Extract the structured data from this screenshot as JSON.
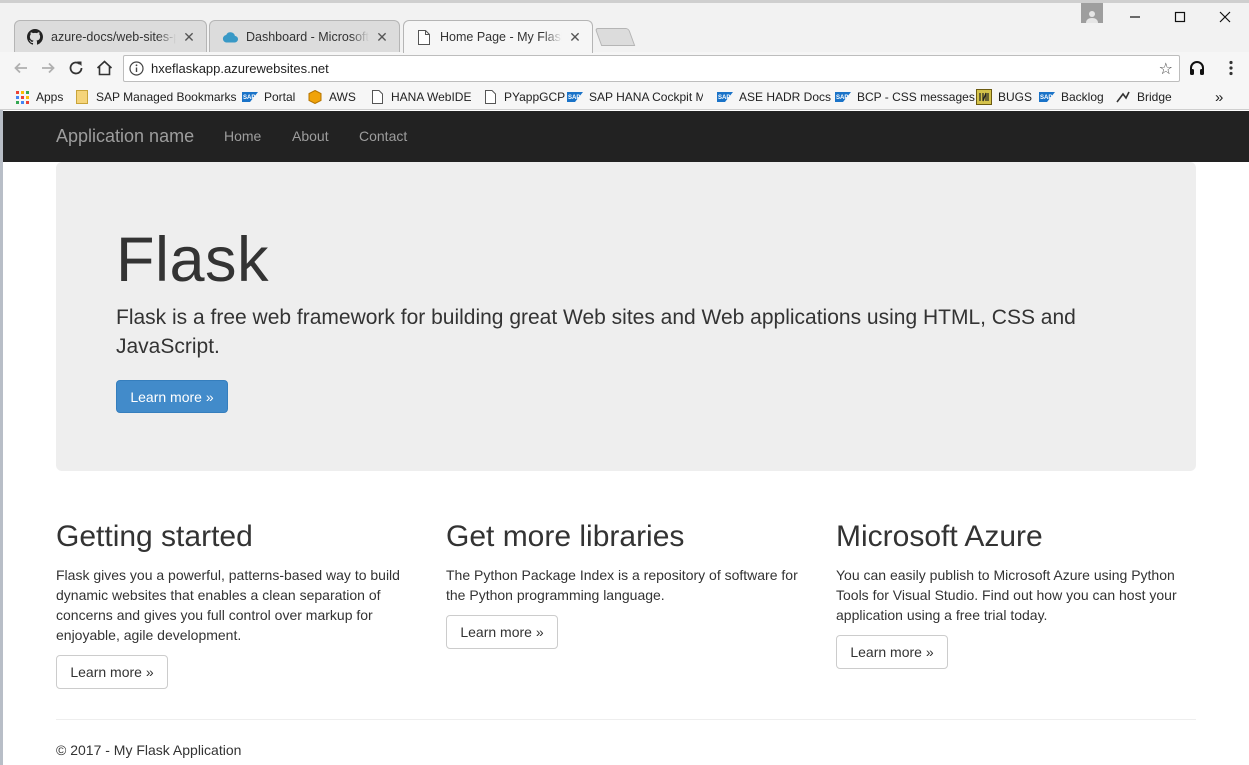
{
  "browser": {
    "tabs": [
      {
        "title": "azure-docs/web-sites-py",
        "icon": "github-icon"
      },
      {
        "title": "Dashboard - Microsoft A",
        "icon": "azure-cloud-icon"
      },
      {
        "title": "Home Page - My Flask Ap",
        "icon": "page-icon",
        "active": true
      }
    ],
    "tab_close": "✕",
    "address": "hxeflaskapp.azurewebsites.net",
    "bookmarks": [
      {
        "label": "Apps",
        "icon": "apps-grid-icon"
      },
      {
        "label": "SAP Managed Bookmarks",
        "icon": "folder-icon"
      },
      {
        "label": "Portal",
        "icon": "sap-icon"
      },
      {
        "label": "AWS",
        "icon": "aws-icon"
      },
      {
        "label": "HANA WebIDE",
        "icon": "page-icon"
      },
      {
        "label": "PYappGCP",
        "icon": "page-icon"
      },
      {
        "label": "SAP HANA Cockpit M",
        "icon": "sap-icon"
      },
      {
        "label": "ASE HADR Docs",
        "icon": "sap-icon"
      },
      {
        "label": "BCP - CSS messages",
        "icon": "sap-icon"
      },
      {
        "label": "BUGS",
        "icon": "bugs-icon"
      },
      {
        "label": "Backlog",
        "icon": "sap-icon"
      },
      {
        "label": "Bridge",
        "icon": "bridge-icon"
      }
    ],
    "overflow": "»"
  },
  "site": {
    "brand": "Application name",
    "nav": [
      "Home",
      "About",
      "Contact"
    ],
    "jumbotron": {
      "title": "Flask",
      "lead": "Flask is a free web framework for building great Web sites and Web applications using HTML, CSS and JavaScript.",
      "button": "Learn more »"
    },
    "columns": [
      {
        "title": "Getting started",
        "text": "Flask gives you a powerful, patterns-based way to build dynamic websites that enables a clean separation of concerns and gives you full control over markup for enjoyable, agile development.",
        "button": "Learn more »"
      },
      {
        "title": "Get more libraries",
        "text": "The Python Package Index is a repository of software for the Python programming language.",
        "button": "Learn more »"
      },
      {
        "title": "Microsoft Azure",
        "text": "You can easily publish to Microsoft Azure using Python Tools for Visual Studio. Find out how you can host your application using a free trial today.",
        "button": "Learn more »"
      }
    ],
    "footer": "© 2017 - My Flask Application"
  },
  "colors": {
    "navbar_bg": "#222222",
    "nav_text": "#9d9d9d",
    "jumbotron_bg": "#eeeeee",
    "primary": "#428bca"
  }
}
